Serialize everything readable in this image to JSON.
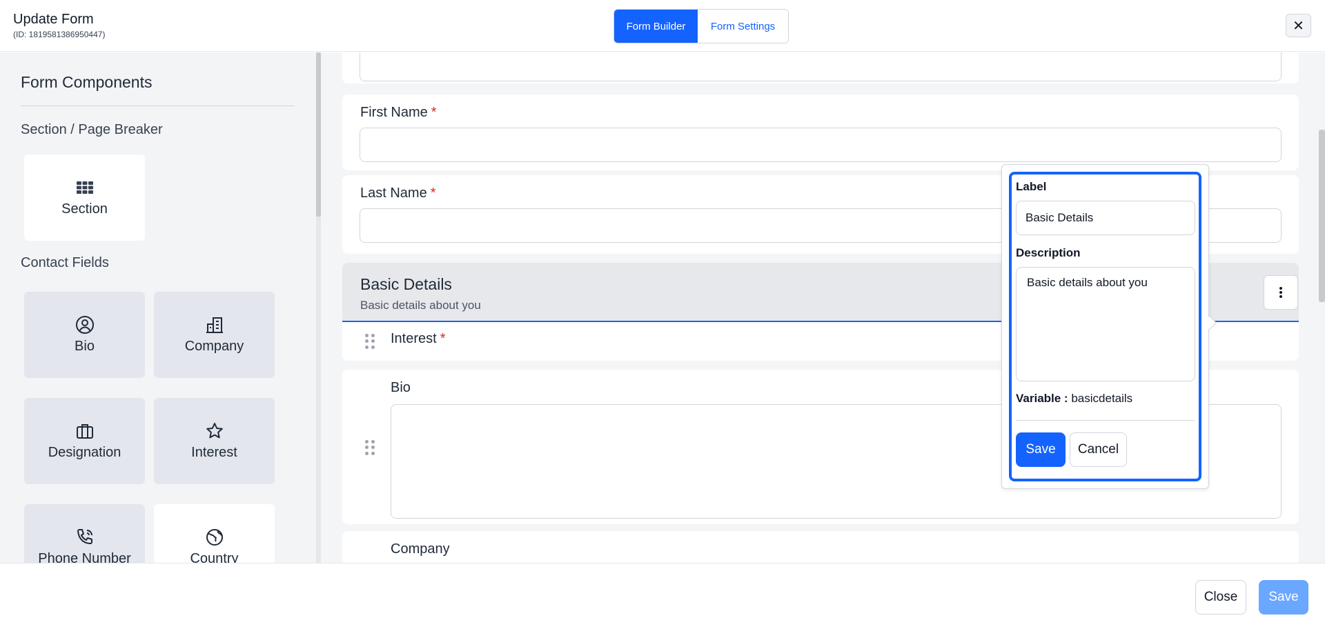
{
  "header": {
    "title": "Update Form",
    "subtitle": "(ID: 1819581386950447)",
    "tabs": [
      {
        "label": "Form Builder"
      },
      {
        "label": "Form Settings"
      }
    ],
    "close_icon": "close-icon"
  },
  "sidebar": {
    "heading": "Form Components",
    "groups": [
      {
        "title": "Section / Page Breaker"
      },
      {
        "title": "Contact Fields"
      }
    ],
    "components": [
      {
        "label": "Section",
        "icon": "grid-icon"
      },
      {
        "label": "Bio",
        "icon": "user-circle-icon"
      },
      {
        "label": "Company",
        "icon": "building-icon"
      },
      {
        "label": "Designation",
        "icon": "briefcase-icon"
      },
      {
        "label": "Interest",
        "icon": "star-icon"
      },
      {
        "label": "Phone Number",
        "icon": "phone-icon"
      },
      {
        "label": "Country",
        "icon": "globe-icon"
      }
    ]
  },
  "canvas": {
    "fields": [
      {
        "label": "First Name",
        "required": "*"
      },
      {
        "label": "Last Name",
        "required": "*"
      }
    ],
    "section": {
      "title": "Basic Details",
      "description": "Basic details about you"
    },
    "section_fields": [
      {
        "label": "Interest",
        "required": "*"
      },
      {
        "label": "Bio"
      },
      {
        "label": "Company"
      }
    ]
  },
  "popover": {
    "label_title": "Label",
    "label_value": "Basic Details",
    "description_title": "Description",
    "description_value": "Basic details about you",
    "variable_label": "Variable :",
    "variable_value": "basicdetails",
    "save": "Save",
    "cancel": "Cancel"
  },
  "footer": {
    "close": "Close",
    "save": "Save"
  },
  "colors": {
    "primary": "#1463ff",
    "disabled_primary": "#6aa7ff",
    "required": "#dc2626"
  }
}
